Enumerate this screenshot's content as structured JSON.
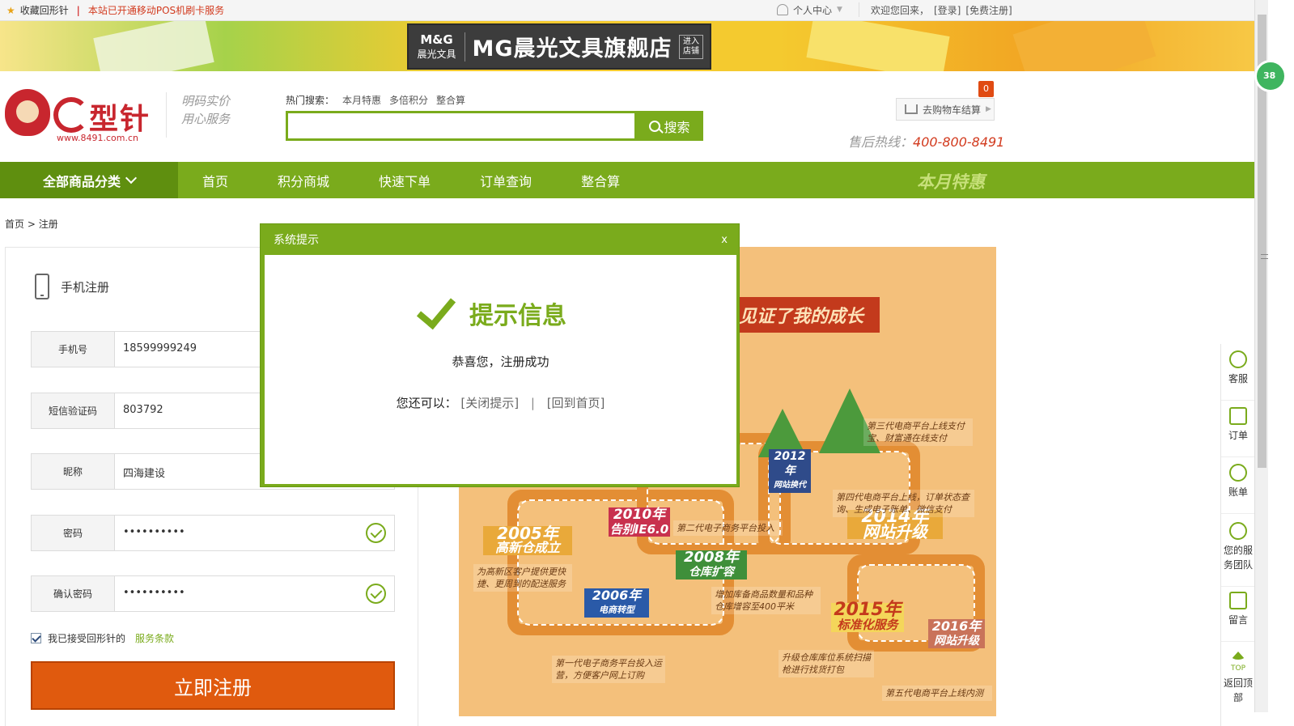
{
  "topbar": {
    "favorite": "收藏回形针",
    "notice": "本站已开通移动POS机刷卡服务",
    "personal_center": "个人中心",
    "welcome": "欢迎您回来，",
    "login": "[登录]",
    "register": "[免费注册]"
  },
  "banner": {
    "brand_logo": "M&G",
    "brand_sub": "晨光文具",
    "brand_title": "MG晨光文具旗舰店",
    "enter_store": "进入店铺"
  },
  "header": {
    "logo_name": "型针",
    "logo_url": "www.8491.com.cn",
    "slogan_line1": "明码实价",
    "slogan_line2": "用心服务",
    "hot_label": "热门搜索：",
    "hot_terms": [
      "本月特惠",
      "多倍积分",
      "整合算"
    ],
    "search_button": "搜索",
    "search_value": "",
    "cart_label": "去购物车结算",
    "cart_count": "0",
    "hotline_label": "售后热线：",
    "hotline_number": "400-800-8491"
  },
  "nav": {
    "all_categories": "全部商品分类",
    "items": [
      "首页",
      "积分商城",
      "快速下单",
      "订单查询",
      "整合算"
    ],
    "promo": "本月特惠"
  },
  "breadcrumb": {
    "home": "首页",
    "sep": ">",
    "current": "注册"
  },
  "register": {
    "title": "手机注册",
    "fields": [
      {
        "label": "手机号",
        "value": "18599999249",
        "valid": false
      },
      {
        "label": "短信验证码",
        "value": "803792",
        "valid": false
      },
      {
        "label": "昵称",
        "value": "四海建设",
        "valid": false
      },
      {
        "label": "密码",
        "value": "••••••••••",
        "valid": true
      },
      {
        "label": "确认密码",
        "value": "••••••••••",
        "valid": true
      }
    ],
    "agree_text": "我已接受回形针的",
    "terms_link": "服务条款",
    "agree_checked": true,
    "submit": "立即注册"
  },
  "infographic": {
    "banner": "见证了我的成长",
    "milestones": [
      {
        "year": "2005年",
        "text": "高新仓成立"
      },
      {
        "year": "2006年",
        "text": "电商转型"
      },
      {
        "year": "2008年",
        "text": "仓库扩容"
      },
      {
        "year": "2010年",
        "text": "告别IE6.0"
      },
      {
        "year": "2012年",
        "text": "网站换代"
      },
      {
        "year": "2014年",
        "text": "网站升级"
      },
      {
        "year": "2015年",
        "text": "标准化服务"
      },
      {
        "year": "2016年",
        "text": "网站升级"
      }
    ],
    "notes": [
      "为高新区客户提供更快捷、更周到的配送服务",
      "第一代电子商务平台投入运营，方便客户网上订购",
      "增加库备商品数量和品种仓库增容至400平米",
      "第二代电子商务平台投入",
      "第三代电商平台上线支付宝、财富通在线支付",
      "第四代电商平台上线，订单状态查询、生成电子账单、微信支付",
      "升级仓库库位系统扫描枪进行找货打包",
      "第五代电商平台上线内测"
    ]
  },
  "modal": {
    "header": "系统提示",
    "close": "x",
    "title": "提示信息",
    "message": "恭喜您，注册成功",
    "options_label": "您还可以：",
    "option_close": "[关闭提示]",
    "option_sep": "|",
    "option_home": "[回到首页]"
  },
  "sidebar": {
    "items": [
      "客服",
      "订单",
      "账单",
      "您的服务团队",
      "留言",
      "返回顶部"
    ],
    "top_label": "TOP"
  },
  "floating_badge": "38",
  "colors": {
    "primary_green": "#7aab1c",
    "accent_orange": "#e05a0e",
    "notice_red": "#d23a1e"
  }
}
